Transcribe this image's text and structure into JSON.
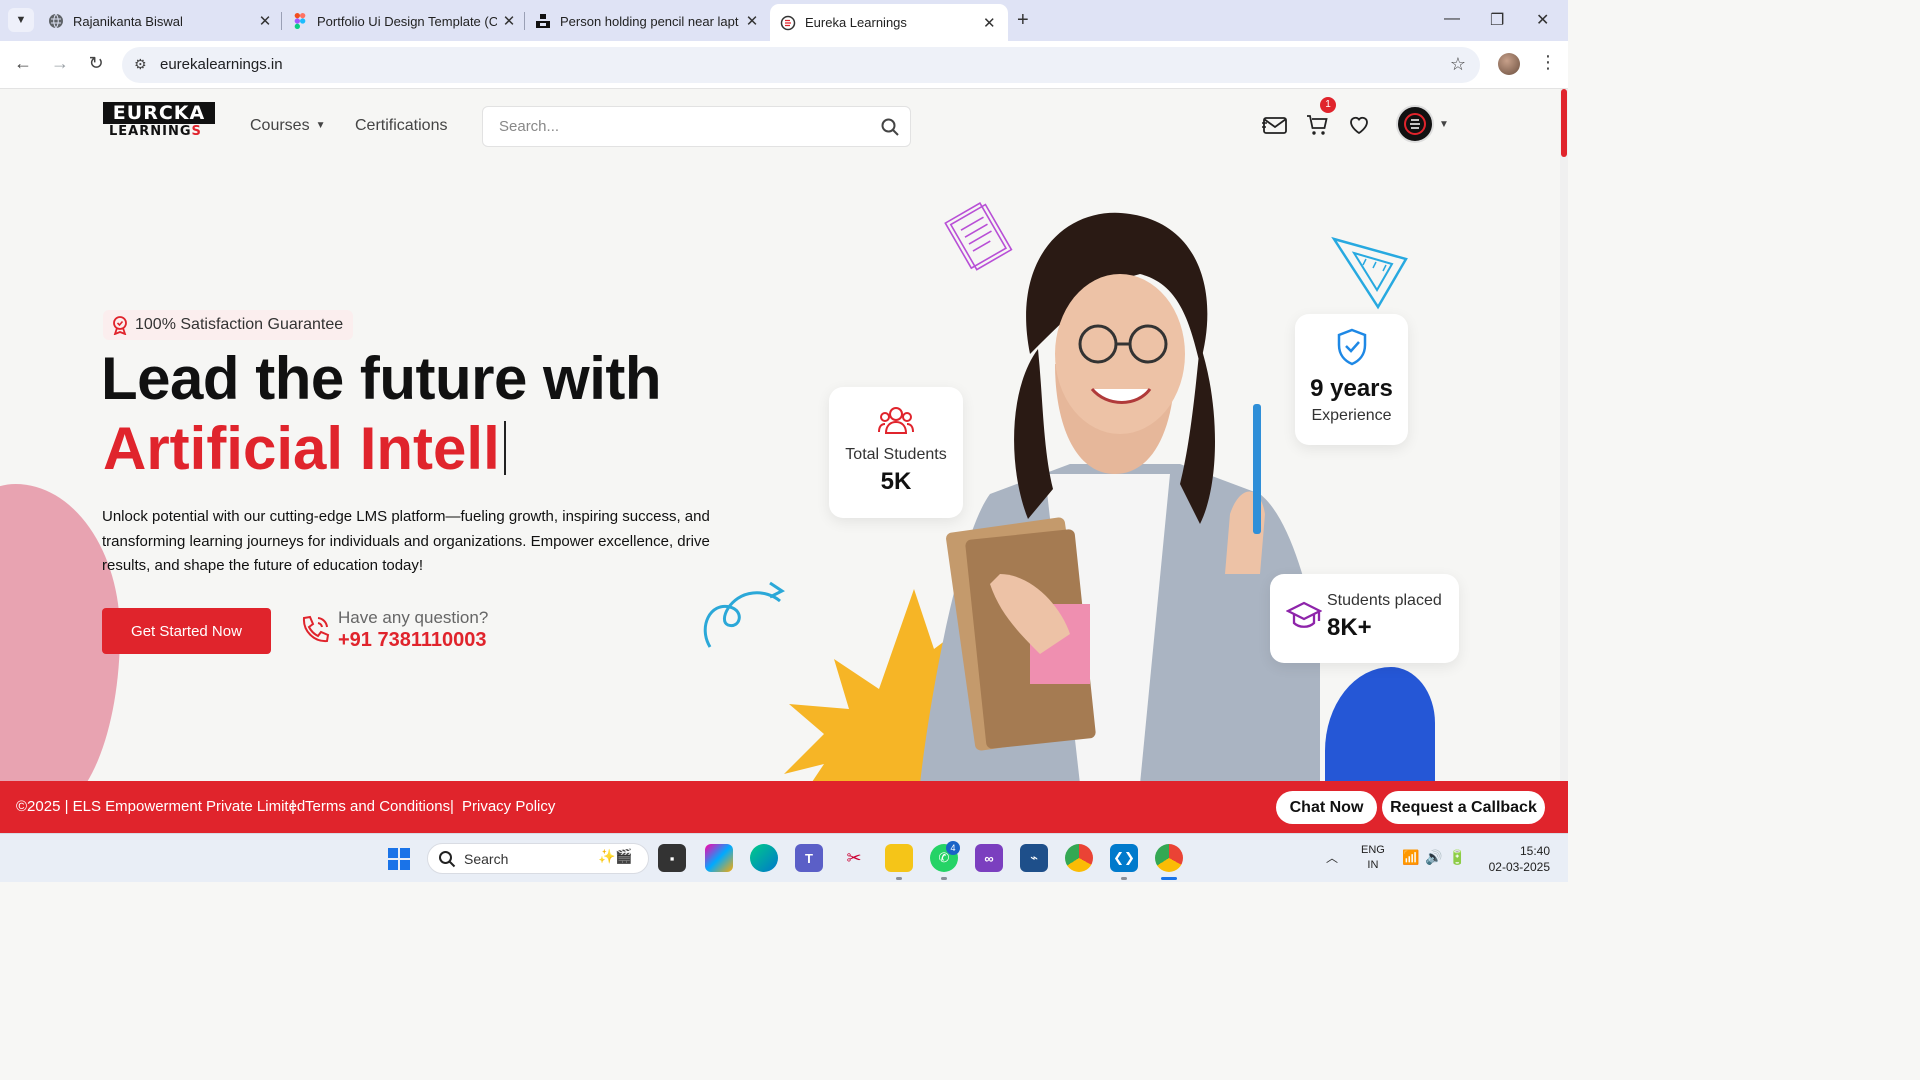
{
  "browser": {
    "tabs": [
      {
        "title": "Rajanikanta Biswal",
        "active": false
      },
      {
        "title": "Portfolio Ui Design Template (C",
        "active": false
      },
      {
        "title": "Person holding pencil near lapt",
        "active": false
      },
      {
        "title": "Eureka Learnings",
        "active": true
      }
    ],
    "new_tab": "+",
    "url": "eurekalearnings.in"
  },
  "site": {
    "logo_top": "EURCKA",
    "logo_bottom_a": "LEARNING",
    "logo_bottom_b": "S",
    "nav": {
      "courses": "Courses",
      "certifications": "Certifications"
    },
    "search_placeholder": "Search...",
    "cart_count": "1"
  },
  "hero": {
    "badge": "100% Satisfaction Guarantee",
    "title_line1": "Lead the future with",
    "title_line2": "Artificial Intell",
    "description": "Unlock potential with our cutting-edge LMS platform—fueling growth, inspiring success, and transforming learning journeys for individuals and organizations. Empower excellence, drive results, and shape the future of education today!",
    "cta": "Get Started Now",
    "question": "Have any question?",
    "phone": "+91 7381110003"
  },
  "stats": {
    "students_label": "Total Students",
    "students_value": "5K",
    "years_value": "9 years",
    "years_label": "Experience",
    "placed_label": "Students placed",
    "placed_value": "8K+"
  },
  "footer": {
    "copyright": "©2025 | ELS Empowerment Private Limited",
    "terms": "Terms and Conditions",
    "privacy": "Privacy Policy",
    "chat": "Chat Now",
    "callback": "Request a Callback"
  },
  "taskbar": {
    "search": "Search",
    "whatsapp_badge": "4",
    "lang_line1": "ENG",
    "lang_line2": "IN",
    "time": "15:40",
    "date": "02-03-2025"
  },
  "colors": {
    "brand_red": "#e0242c",
    "pink_blob": "#e8a3b1",
    "accent_yellow": "#f6b526",
    "accent_blue": "#2557d6"
  }
}
